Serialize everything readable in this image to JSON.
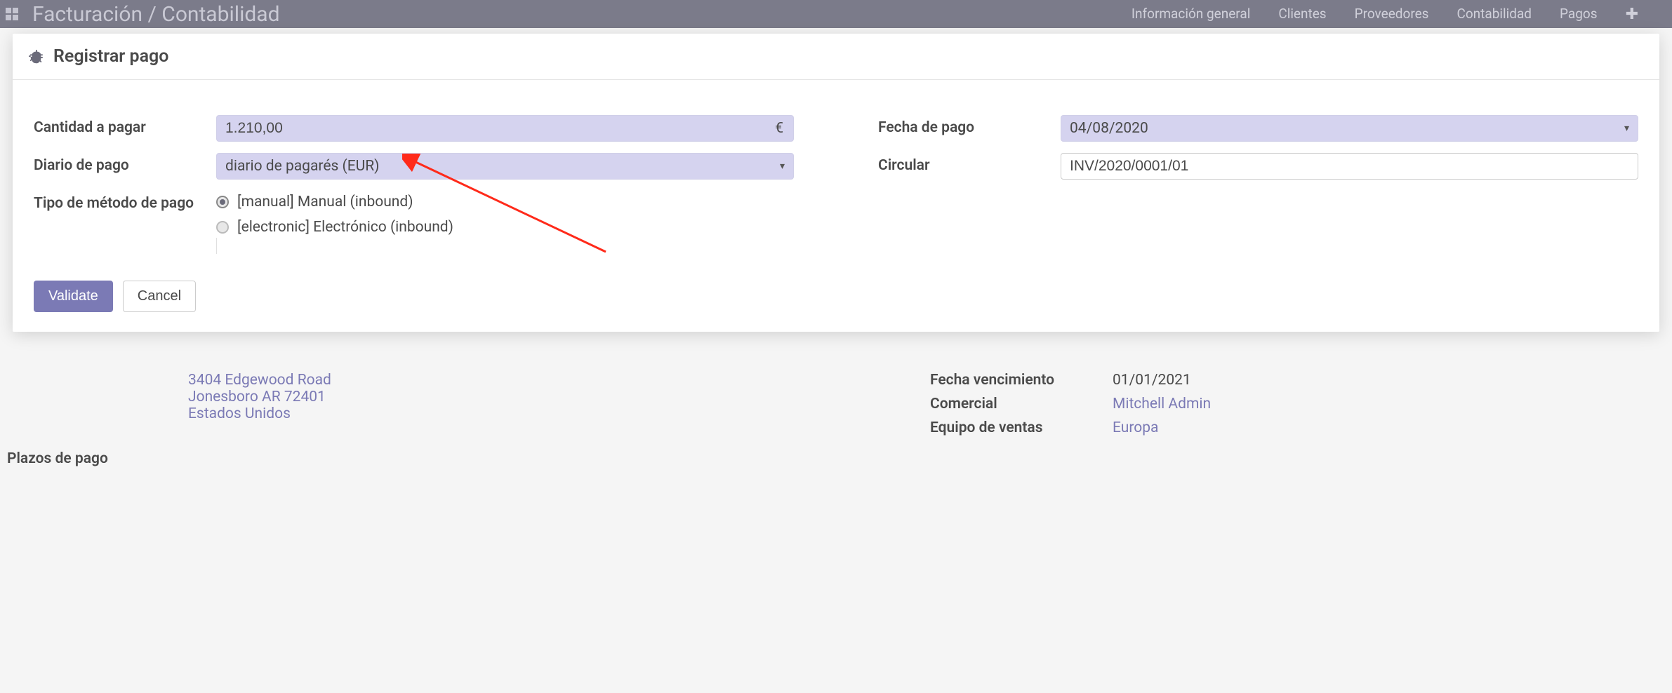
{
  "navbar": {
    "brand": "Facturación / Contabilidad",
    "menu": [
      "Información general",
      "Clientes",
      "Proveedores",
      "Contabilidad",
      "Pagos"
    ]
  },
  "modal": {
    "title": "Registrar pago",
    "fields": {
      "amount_label": "Cantidad a pagar",
      "amount_value": "1.210,00",
      "amount_currency": "€",
      "journal_label": "Diario de pago",
      "journal_value": "diario de pagarés (EUR)",
      "method_label": "Tipo de método de pago",
      "method_options": [
        {
          "value": "manual",
          "label": "[manual] Manual (inbound)",
          "checked": true
        },
        {
          "value": "electronic",
          "label": "[electronic] Electrónico (inbound)",
          "checked": false
        }
      ],
      "date_label": "Fecha de pago",
      "date_value": "04/08/2020",
      "memo_label": "Circular",
      "memo_value": "INV/2020/0001/01"
    },
    "buttons": {
      "validate": "Validate",
      "cancel": "Cancel"
    }
  },
  "background": {
    "address_line1": "3404 Edgewood Road",
    "address_line2": "Jonesboro AR 72401",
    "address_country": "Estados Unidos",
    "due_label": "Fecha vencimiento",
    "due_value": "01/01/2021",
    "sales_label": "Comercial",
    "sales_value": "Mitchell Admin",
    "team_label": "Equipo de ventas",
    "team_value": "Europa",
    "payterm_label": "Plazos de pago"
  }
}
